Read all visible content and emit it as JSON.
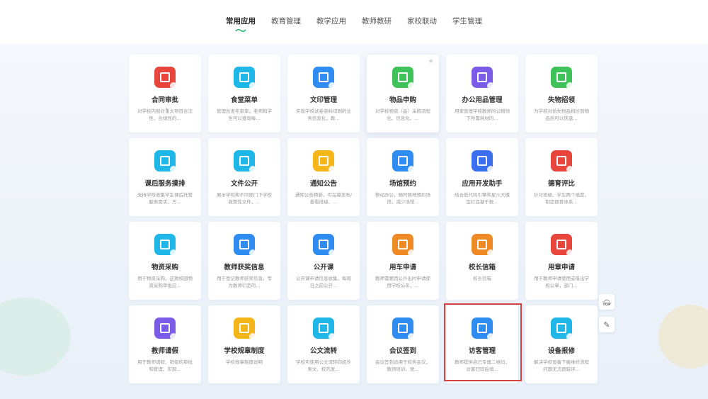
{
  "tabs": [
    {
      "label": "常用应用",
      "active": true
    },
    {
      "label": "教育管理",
      "active": false
    },
    {
      "label": "教学应用",
      "active": false
    },
    {
      "label": "教师教研",
      "active": false
    },
    {
      "label": "家校联动",
      "active": false
    },
    {
      "label": "学生管理",
      "active": false
    }
  ],
  "apps": [
    {
      "title": "合同审批",
      "desc": "对学校内部对重大项目合法性、合规性的...",
      "color": "#e8453c"
    },
    {
      "title": "食堂菜单",
      "desc": "管理员发布菜单，老师和学生可以查询每...",
      "color": "#1fb6e8"
    },
    {
      "title": "文印管理",
      "desc": "实现学校试卷资料印刷的业务信息化，教...",
      "color": "#2f8cf0"
    },
    {
      "title": "物品申购",
      "desc": "对学校物资（品）采购流程化、信息化、...",
      "color": "#3fc25a"
    },
    {
      "title": "办公用品管理",
      "desc": "用来管理学校教师的公物领下所需耗材的...",
      "color": "#7b5ce8"
    },
    {
      "title": "失物招领",
      "desc": "为学校对拾失物品和捡到物品后可以快速...",
      "color": "#3fc25a"
    },
    {
      "title": "课后服务摸排",
      "desc": "支持学校收集学生课后托管服务需求，方...",
      "color": "#1fb6e8"
    },
    {
      "title": "文件公开",
      "desc": "展示学校和不同部门下学校政策性文件，...",
      "color": "#1fb6e8"
    },
    {
      "title": "通知公告",
      "desc": "通知公告精新，可在線发布/查看班级、...",
      "color": "#f5b619"
    },
    {
      "title": "场馆预约",
      "desc": "移动办公，随时随地预约场馆，减少场馆...",
      "color": "#2f8cf0"
    },
    {
      "title": "应用开发助手",
      "desc": "结合低代码引擎和星火大模型打造基于数...",
      "color": "#3a6ff0"
    },
    {
      "title": "德育评比",
      "desc": "针对班级、学生两个维度，制定德育体系...",
      "color": "#e8453c"
    },
    {
      "title": "物资采购",
      "desc": "用于物资采购，这款校园物资采购审批应...",
      "color": "#1fb6e8"
    },
    {
      "title": "教师获奖信息",
      "desc": "用于登记教师获奖信息，专为教师们定的...",
      "color": "#2f8cf0"
    },
    {
      "title": "公开课",
      "desc": "公开课申请信息收集，每周日之前公开...",
      "color": "#2f8cf0"
    },
    {
      "title": "用车申请",
      "desc": "教师需要因公外出时申请使用学校公车，...",
      "color": "#f08a24"
    },
    {
      "title": "校长信箱",
      "desc": "校长信箱",
      "color": "#f08a24"
    },
    {
      "title": "用章申请",
      "desc": "用于教师申请使用或借出学校公章，部门...",
      "color": "#e8453c"
    },
    {
      "title": "教师请假",
      "desc": "用于教师请假、销假的审批和管理，实现...",
      "color": "#7b5ce8"
    },
    {
      "title": "学校规章制度",
      "desc": "学校规章制度说明",
      "color": "#f5b619"
    },
    {
      "title": "公文流转",
      "desc": "学校可使用公文流转向校外来文、校内发...",
      "color": "#1fb6e8"
    },
    {
      "title": "会议签到",
      "desc": "会议签到适用于校务会议，教师培训，党...",
      "color": "#2f8cf0"
    },
    {
      "title": "访客管理",
      "desc": "教师提供自己专属二维码，访客扫码后填...",
      "color": "#2f8cf0"
    },
    {
      "title": "设备报修",
      "desc": "解决学校设备下报维修流程问题无法跟踪评...",
      "color": "#1fb6e8"
    }
  ],
  "side": {
    "top_label": "TOP"
  }
}
